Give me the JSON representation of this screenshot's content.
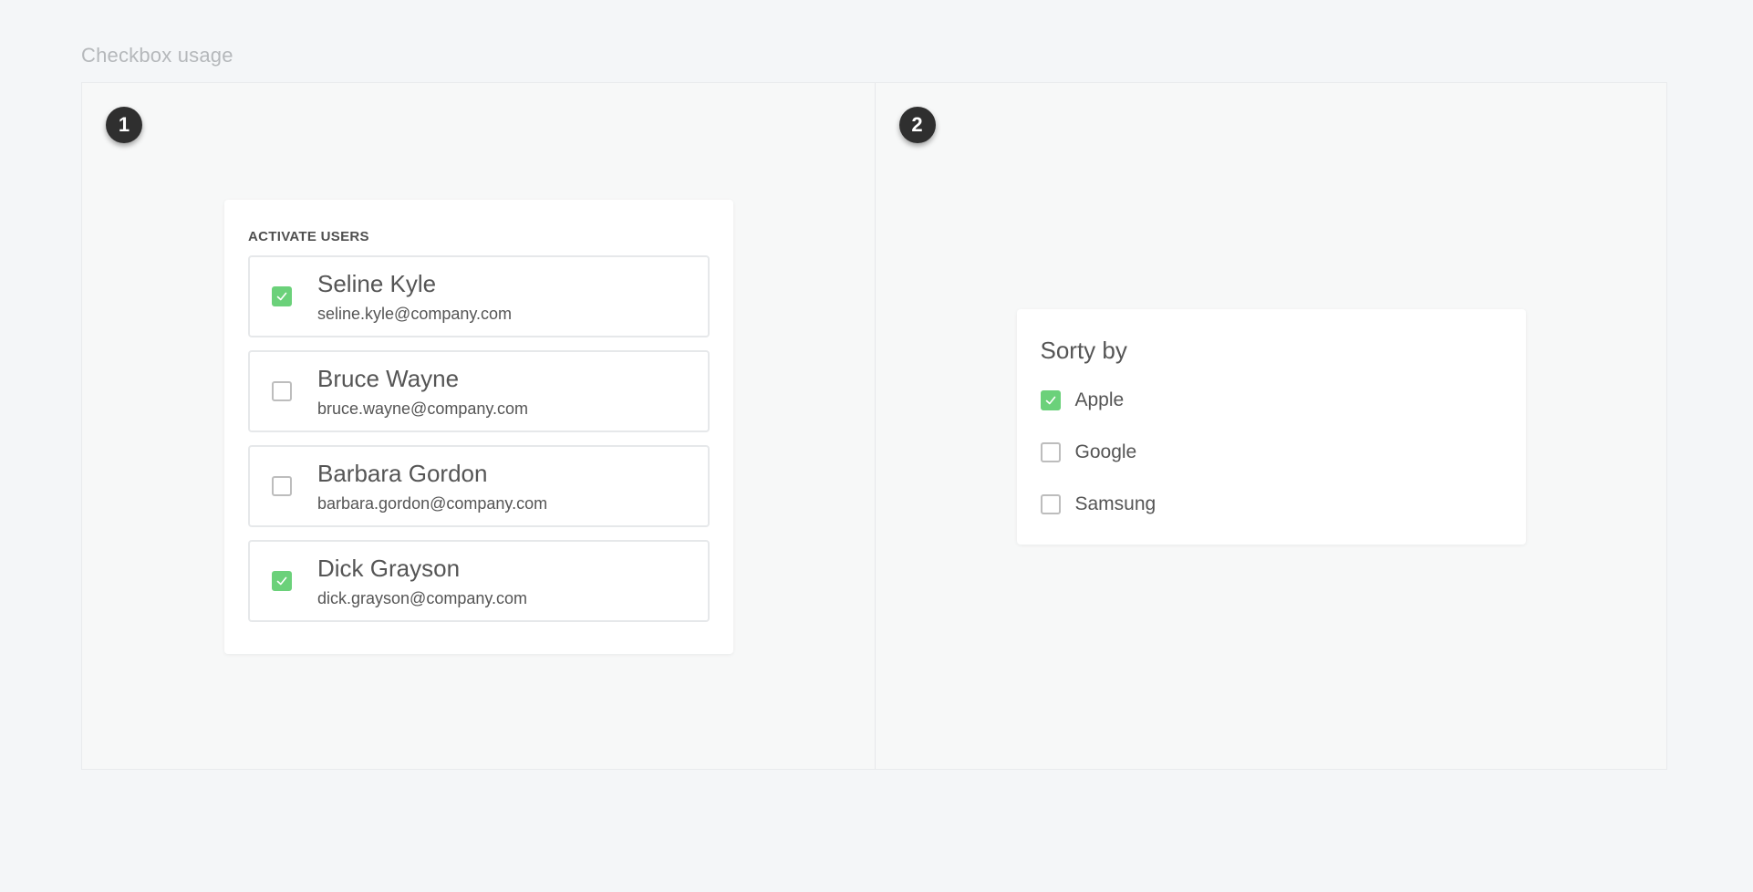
{
  "page": {
    "title": "Checkbox usage"
  },
  "panels": [
    {
      "badge": "1"
    },
    {
      "badge": "2"
    }
  ],
  "activate_users": {
    "heading": "ACTIVATE USERS",
    "users": [
      {
        "name": "Seline Kyle",
        "email": "seline.kyle@company.com",
        "checked": true
      },
      {
        "name": "Bruce Wayne",
        "email": "bruce.wayne@company.com",
        "checked": false
      },
      {
        "name": "Barbara Gordon",
        "email": "barbara.gordon@company.com",
        "checked": false
      },
      {
        "name": "Dick Grayson",
        "email": "dick.grayson@company.com",
        "checked": true
      }
    ]
  },
  "sort_by": {
    "title": "Sorty by",
    "options": [
      {
        "label": "Apple",
        "checked": true
      },
      {
        "label": "Google",
        "checked": false
      },
      {
        "label": "Samsung",
        "checked": false
      }
    ]
  },
  "colors": {
    "checkbox_checked": "#6bd17a",
    "checkbox_border": "#bdbdbd",
    "badge_bg": "#2f2f2f"
  },
  "icons": {
    "check": "check-icon"
  }
}
